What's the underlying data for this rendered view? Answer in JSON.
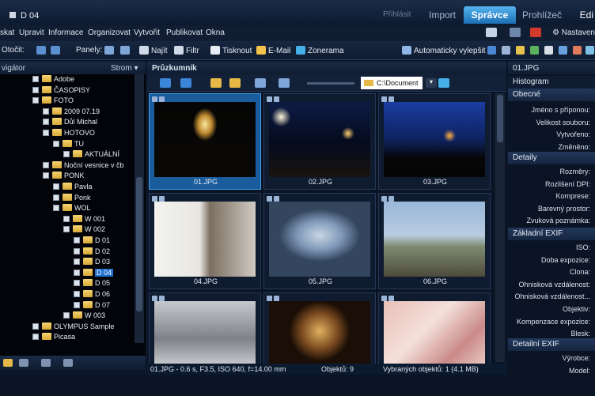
{
  "window": {
    "title": "D 04",
    "login": "Přihlásit"
  },
  "modes": {
    "import": "Import",
    "spravce": "Správce",
    "prohlizec": "Prohlížeč",
    "edit": "Edi"
  },
  "menu": [
    "skat",
    "Upravit",
    "Informace",
    "Organizovat",
    "Vytvořit",
    "Publikovat",
    "Okna"
  ],
  "settings_label": "Nastaven",
  "toolbar": {
    "otocit": "Otočit:",
    "panely": "Panely:",
    "najit": "Najít",
    "filtr": "Filtr",
    "tisknout": "Tisknout",
    "email": "E-Mail",
    "zonerama": "Zonerama",
    "auto_enhance": "Automaticky vylepšit"
  },
  "nav": {
    "title": "vigátor",
    "strom": "Strom",
    "tree": [
      {
        "label": "Adobe",
        "indent": 1
      },
      {
        "label": "ČASOPISY",
        "indent": 1
      },
      {
        "label": "FOTO",
        "indent": 1
      },
      {
        "label": "2009 07.19",
        "indent": 2
      },
      {
        "label": "Důl Michal",
        "indent": 2
      },
      {
        "label": "HOTOVO",
        "indent": 2
      },
      {
        "label": "TU",
        "indent": 3
      },
      {
        "label": "AKTUÁLNÍ",
        "indent": 4
      },
      {
        "label": "Noční vesnice v čb",
        "indent": 2
      },
      {
        "label": "PONK",
        "indent": 2
      },
      {
        "label": "Pavla",
        "indent": 3
      },
      {
        "label": "Ponk",
        "indent": 3
      },
      {
        "label": "WOL",
        "indent": 3
      },
      {
        "label": "W 001",
        "indent": 4
      },
      {
        "label": "W 002",
        "indent": 4
      },
      {
        "label": "D 01",
        "indent": 5
      },
      {
        "label": "D 02",
        "indent": 5
      },
      {
        "label": "D 03",
        "indent": 5
      },
      {
        "label": "D 04",
        "indent": 5,
        "selected": true
      },
      {
        "label": "D 05",
        "indent": 5
      },
      {
        "label": "D 06",
        "indent": 5
      },
      {
        "label": "D 07",
        "indent": 5
      },
      {
        "label": "W 003",
        "indent": 4
      },
      {
        "label": "OLYMPUS Sample",
        "indent": 1
      },
      {
        "label": "Picasa",
        "indent": 1
      }
    ]
  },
  "main": {
    "title": "Průzkumník",
    "path": "C:\\Document",
    "thumbnails": [
      {
        "caption": "01.JPG",
        "selected": true
      },
      {
        "caption": "02.JPG"
      },
      {
        "caption": "03.JPG"
      },
      {
        "caption": "04.JPG"
      },
      {
        "caption": "05.JPG"
      },
      {
        "caption": "06.JPG"
      },
      {
        "caption": ""
      },
      {
        "caption": ""
      },
      {
        "caption": ""
      }
    ]
  },
  "status": {
    "info": "01.JPG - 0.6 s, F3.5, ISO 640, f=14.00 mm",
    "objects": "Objektů: 9",
    "selected": "Vybraných objektů: 1 (4.1 MB)"
  },
  "info_panel": {
    "title": "01.JPG",
    "histogram": "Histogram",
    "obecne": "Obecné",
    "obecne_fields": [
      "Jméno s příponou:",
      "Velikost souboru:",
      "Vytvořeno:",
      "Změněno:"
    ],
    "detaily": "Detaily",
    "detaily_fields": [
      "Rozměry:",
      "Rozlišení DPI:",
      "Komprese:",
      "Barevný prostor:",
      "Zvuková poznámka:"
    ],
    "exif": "Základní EXIF",
    "exif_fields": [
      "ISO:",
      "Doba expozice:",
      "Clona:",
      "Ohnisková vzdálenost:",
      "Ohnisková vzdálenost...",
      "Objektiv:",
      "Kompenzace expozice:",
      "Blesk:"
    ],
    "detailni_exif": "Detailní EXIF",
    "detailni_fields": [
      "Výrobce:",
      "Model:"
    ]
  },
  "colors": {
    "accent": "#1c6eb4",
    "selection": "#1f6fd0",
    "background": "#0b1628"
  }
}
